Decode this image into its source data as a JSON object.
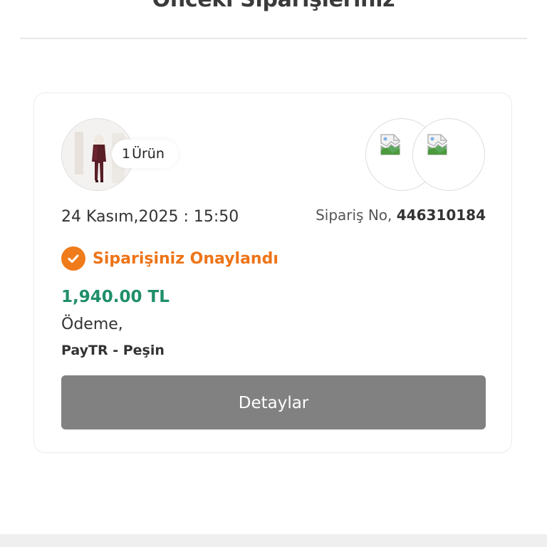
{
  "page": {
    "title": "Önceki Siparişleriniz"
  },
  "order": {
    "item_count_number": "1",
    "item_count_label": "Ürün",
    "date": "24 Kasım,2025 : 15:50",
    "order_no_label": "Sipariş No,",
    "order_no_value": "446310184",
    "status": "Siparişiniz Onaylandı",
    "status_color": "#f07b1a",
    "price": "1,940.00 TL",
    "price_color": "#1f8f68",
    "payment_label": "Ödeme,",
    "payment_method": "PayTR - Peşin",
    "details_button": "Detaylar",
    "details_button_color": "#818181"
  },
  "icons": {
    "status": "check-circle-icon",
    "broken_image": "broken-image-icon"
  }
}
